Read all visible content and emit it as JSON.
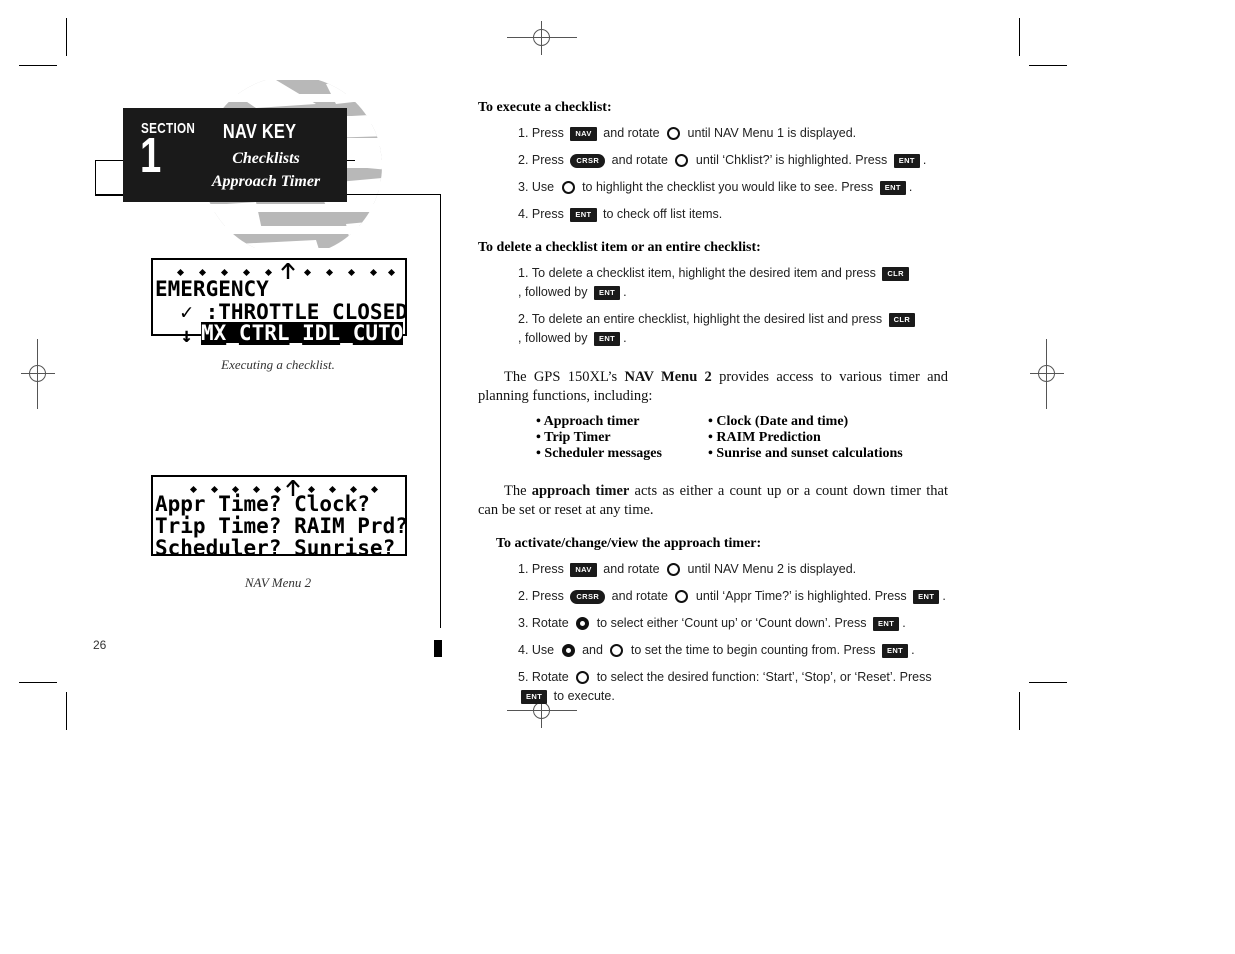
{
  "header": {
    "section_label": "SECTION",
    "section_number": "1",
    "title": "NAV KEY",
    "subtitle_1": "Checklists",
    "subtitle_2": "Approach Timer"
  },
  "figures": [
    {
      "name": "checklist-execution-display",
      "lines": [
        {
          "text": "EMERGENCY",
          "inverse": false
        },
        {
          "text": "  ✓ :THROTTLE CLOSED",
          "inverse": false
        },
        {
          "text": "  ↓ :",
          "suffix": "MX_CTRL_IDL_CUTO",
          "inverse": true
        }
      ],
      "caption": "Executing a checklist."
    },
    {
      "name": "nav-menu-2-display",
      "lines": [
        {
          "text": "Appr Time? Clock?",
          "inverse": false
        },
        {
          "text": "Trip Time? RAIM Prd?",
          "inverse": false
        },
        {
          "text": "Scheduler? Sunrise?",
          "inverse": false
        }
      ],
      "caption": "NAV Menu 2"
    }
  ],
  "sections": [
    {
      "heading": "To execute a checklist:",
      "steps": [
        {
          "num": "1.",
          "parts": [
            {
              "type": "text",
              "value": "Press "
            },
            {
              "type": "key",
              "value": "NAV",
              "shape": "rect"
            },
            {
              "type": "text",
              "value": " and rotate "
            },
            {
              "type": "knob",
              "value": "outer-knob"
            },
            {
              "type": "text",
              "value": " until NAV Menu 1 is displayed."
            }
          ]
        },
        {
          "num": "2.",
          "parts": [
            {
              "type": "text",
              "value": "Press "
            },
            {
              "type": "key",
              "value": "CRSR",
              "shape": "round"
            },
            {
              "type": "text",
              "value": " and rotate "
            },
            {
              "type": "knob",
              "value": "outer-knob"
            },
            {
              "type": "text",
              "value": " until ‘Chklist?’ is highlighted. Press "
            },
            {
              "type": "key",
              "value": "ENT",
              "shape": "rect"
            },
            {
              "type": "text",
              "value": "."
            }
          ]
        },
        {
          "num": "3.",
          "parts": [
            {
              "type": "text",
              "value": "Use "
            },
            {
              "type": "knob",
              "value": "outer-knob"
            },
            {
              "type": "text",
              "value": " to highlight the checklist you would like to see. Press "
            },
            {
              "type": "key",
              "value": "ENT",
              "shape": "rect"
            },
            {
              "type": "text",
              "value": "."
            }
          ]
        },
        {
          "num": "4.",
          "parts": [
            {
              "type": "text",
              "value": "Press "
            },
            {
              "type": "key",
              "value": "ENT",
              "shape": "rect"
            },
            {
              "type": "text",
              "value": " to check off list items."
            }
          ]
        }
      ]
    },
    {
      "heading": "To delete a checklist item or an entire checklist:",
      "steps": [
        {
          "num": "1.",
          "parts": [
            {
              "type": "text",
              "value": "To delete a checklist item, highlight the desired item and press "
            },
            {
              "type": "key",
              "value": "CLR",
              "shape": "rect"
            },
            {
              "type": "text",
              "value": ", followed by "
            },
            {
              "type": "key",
              "value": "ENT",
              "shape": "rect"
            },
            {
              "type": "text",
              "value": "."
            }
          ]
        },
        {
          "num": "2.",
          "parts": [
            {
              "type": "text",
              "value": "To delete an entire checklist, highlight the desired list and press "
            },
            {
              "type": "key",
              "value": "CLR",
              "shape": "rect"
            },
            {
              "type": "text",
              "value": ", followed by "
            },
            {
              "type": "key",
              "value": "ENT",
              "shape": "rect"
            },
            {
              "type": "text",
              "value": "."
            }
          ]
        }
      ]
    }
  ],
  "paragraph_1": {
    "before": "The GPS 150XL’s ",
    "bold": "NAV Menu 2",
    "after": " provides access to various timer and planning functions, including:"
  },
  "bullet_columns": {
    "left": [
      "Approach timer",
      "Trip Timer",
      "Scheduler messages"
    ],
    "right": [
      "Clock (Date and time)",
      "RAIM Prediction",
      "Sunrise and sunset calculations"
    ]
  },
  "paragraph_2": {
    "before": "The ",
    "bold": "approach timer",
    "after": " acts as either a count up or a count down timer that can be set or reset at any time."
  },
  "section_timer": {
    "heading": "To activate/change/view the approach timer:",
    "steps": [
      {
        "num": "1.",
        "parts": [
          {
            "type": "text",
            "value": "Press "
          },
          {
            "type": "key",
            "value": "NAV",
            "shape": "rect"
          },
          {
            "type": "text",
            "value": " and rotate "
          },
          {
            "type": "knob",
            "value": "outer-knob"
          },
          {
            "type": "text",
            "value": " until NAV Menu 2 is displayed."
          }
        ]
      },
      {
        "num": "2.",
        "parts": [
          {
            "type": "text",
            "value": "Press "
          },
          {
            "type": "key",
            "value": "CRSR",
            "shape": "round"
          },
          {
            "type": "text",
            "value": " and rotate "
          },
          {
            "type": "knob",
            "value": "outer-knob"
          },
          {
            "type": "text",
            "value": " until ‘Appr Time?’ is highlighted. Press "
          },
          {
            "type": "key",
            "value": "ENT",
            "shape": "rect"
          },
          {
            "type": "text",
            "value": "."
          }
        ]
      },
      {
        "num": "3.",
        "parts": [
          {
            "type": "text",
            "value": "Rotate "
          },
          {
            "type": "knob",
            "value": "inner-knob"
          },
          {
            "type": "text",
            "value": " to select either ‘Count up’ or ‘Count down’. Press "
          },
          {
            "type": "key",
            "value": "ENT",
            "shape": "rect"
          },
          {
            "type": "text",
            "value": "."
          }
        ]
      },
      {
        "num": "4.",
        "parts": [
          {
            "type": "text",
            "value": "Use "
          },
          {
            "type": "knob",
            "value": "inner-knob"
          },
          {
            "type": "text",
            "value": " and "
          },
          {
            "type": "knob",
            "value": "outer-knob"
          },
          {
            "type": "text",
            "value": " to set the time to begin counting from. Press "
          },
          {
            "type": "key",
            "value": "ENT",
            "shape": "rect"
          },
          {
            "type": "text",
            "value": "."
          }
        ]
      },
      {
        "num": "5.",
        "parts": [
          {
            "type": "text",
            "value": "Rotate "
          },
          {
            "type": "knob",
            "value": "outer-knob"
          },
          {
            "type": "text",
            "value": " to select the desired function: ‘Start’, ‘Stop’, or ‘Reset’. Press "
          },
          {
            "type": "key",
            "value": "ENT",
            "shape": "rect"
          },
          {
            "type": "text",
            "value": " to execute."
          }
        ]
      }
    ]
  },
  "page_number": "26",
  "colors": {
    "ink": "#000000",
    "header_block": "#1a1a1a",
    "watermark": "#b8b8b8"
  }
}
